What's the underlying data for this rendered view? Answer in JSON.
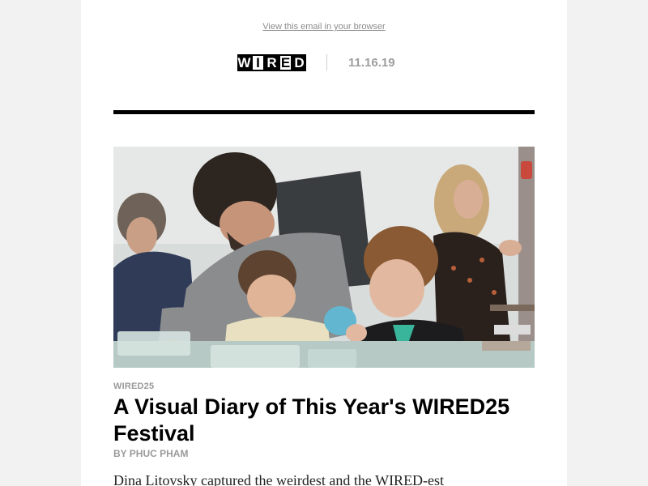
{
  "email": {
    "browser_link": "View this email in your browser",
    "logo": {
      "letters": [
        "W",
        "I",
        "R",
        "E",
        "D"
      ],
      "alt": "WIRED"
    },
    "date": "11.16.19"
  },
  "article": {
    "kicker": "WIRED25",
    "headline": "A Visual Diary of This Year's WIRED25 Festival",
    "byline": "BY PHUC PHAM",
    "dek": "Dina Litovsky captured the weirdest and the WIRED-est"
  },
  "colors": {
    "page_background": "#f2f2f2",
    "email_background": "#ffffff",
    "rule": "#000000",
    "muted_text": "#9a9a9a"
  }
}
